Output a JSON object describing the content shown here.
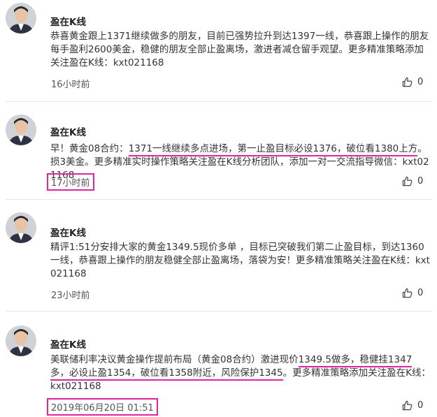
{
  "posts": [
    {
      "author": "盈在K线",
      "text": "恭喜黄金跟上1371继续做多的朋友，目前已强势拉升到达1397一线，恭喜跟上操作的朋友每手盈利2600美金，稳健的朋友全部止盈离场，激进者减仓留手观望。更多精准策略添加关注盈在K线：kxt021168",
      "time": "16小时前",
      "likes": "0"
    },
    {
      "author": "盈在K线",
      "text_pre": "早！黄金08合约：",
      "text_ul": "1371一线继续多点进场，第一止盈目标必设1376，破位看1380上方",
      "text_post": "。损3美金。更多精准实时操作策略关注盈在K线分析团队，添加一对一交流指导微信：kxt021168",
      "time": "17小时前",
      "likes": "0"
    },
    {
      "author": "盈在K线",
      "text": "精评1:51分安排大家的黄金1349.5现价多单 ，目标已突破我们第二止盈目标，到达1360一线，恭喜跟上操作的朋友稳健全部止盈离场，落袋为安！更多精准策略关注盈在K线：kxt021168",
      "time": "23小时前",
      "likes": "0"
    },
    {
      "author": "盈在K线",
      "text_pre": "美联储利率决议黄金操作提前布局（黄金08合约）激进现价",
      "text_ul1": "1349.5做多，稳健挂1347多，必设止盈1354，破位看1358附近，风险保护1345",
      "text_post": "。更多精准策略添加关注盈在K线：kxt021168",
      "time": "2019年06月20日 01:51",
      "likes": "0"
    }
  ]
}
